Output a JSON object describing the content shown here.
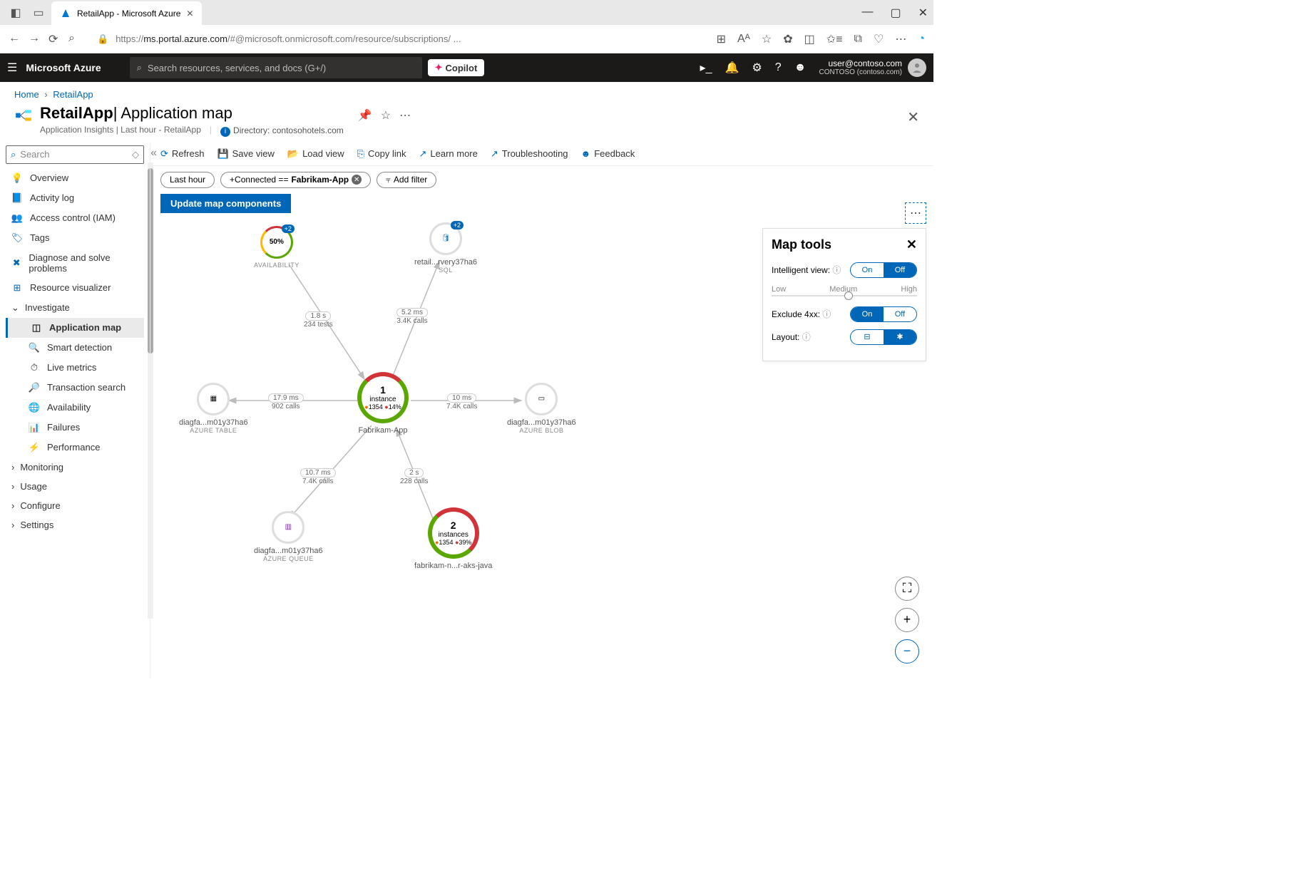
{
  "browser": {
    "tab_title": "RetailApp - Microsoft Azure",
    "url_display_prefix": "https://",
    "url_display_domain": "ms.portal.azure.com",
    "url_display_suffix": "/#@microsoft.onmicrosoft.com/resource/subscriptions/ ..."
  },
  "azure_header": {
    "brand": "Microsoft Azure",
    "search_placeholder": "Search resources, services, and docs (G+/)",
    "copilot": "Copilot",
    "user_email": "user@contoso.com",
    "tenant": "CONTOSO (contoso.com)"
  },
  "breadcrumb": {
    "home": "Home",
    "resource": "RetailApp"
  },
  "page": {
    "title_main": "RetailApp",
    "title_sep": "| ",
    "title_sub": "Application map",
    "subtitle": "Application Insights | Last hour - RetailApp",
    "directory_label": "Directory: ",
    "directory_value": "contosohotels.com"
  },
  "sidebar": {
    "search_placeholder": "Search",
    "items": [
      {
        "icon": "bulb",
        "color": "#8661c5",
        "label": "Overview"
      },
      {
        "icon": "log",
        "color": "#0067b8",
        "label": "Activity log"
      },
      {
        "icon": "iam",
        "color": "#0067b8",
        "label": "Access control (IAM)"
      },
      {
        "icon": "tag",
        "color": "#0067b8",
        "label": "Tags"
      },
      {
        "icon": "diag",
        "color": "#0067b8",
        "label": "Diagnose and solve problems"
      },
      {
        "icon": "viz",
        "color": "#0067b8",
        "label": "Resource visualizer"
      }
    ],
    "investigate_label": "Investigate",
    "investigate": [
      {
        "icon": "map",
        "label": "Application map",
        "selected": true
      },
      {
        "icon": "detect",
        "label": "Smart detection"
      },
      {
        "icon": "live",
        "label": "Live metrics"
      },
      {
        "icon": "search",
        "label": "Transaction search"
      },
      {
        "icon": "avail",
        "label": "Availability"
      },
      {
        "icon": "fail",
        "label": "Failures"
      },
      {
        "icon": "perf",
        "label": "Performance"
      }
    ],
    "groups": [
      "Monitoring",
      "Usage",
      "Configure",
      "Settings"
    ]
  },
  "commands": {
    "refresh": "Refresh",
    "save_view": "Save view",
    "load_view": "Load view",
    "copy_link": "Copy link",
    "learn_more": "Learn more",
    "troubleshooting": "Troubleshooting",
    "feedback": "Feedback"
  },
  "filters": {
    "time": "Last hour",
    "connected_prefix": "+Connected == ",
    "connected_value": "Fabrikam-App",
    "add": "Add filter"
  },
  "update_button": "Update map components",
  "map_tools": {
    "title": "Map tools",
    "intelligent_view": "Intelligent view:",
    "on": "On",
    "off": "Off",
    "low": "Low",
    "medium": "Medium",
    "high": "High",
    "exclude_4xx": "Exclude 4xx:",
    "layout": "Layout:"
  },
  "map": {
    "nodes": {
      "availability": {
        "center": "50%",
        "badge": "+2",
        "label": "AVAILABILITY"
      },
      "sql": {
        "badge": "+2",
        "label": "retail...rvery37ha6",
        "sub": "SQL"
      },
      "fabrikam": {
        "num": "1",
        "text": "instance",
        "m1": "1354",
        "m2": "14%",
        "label": "Fabrikam-App"
      },
      "table": {
        "label": "diagfa...m01y37ha6",
        "sub": "AZURE TABLE"
      },
      "blob": {
        "label": "diagfa...m01y37ha6",
        "sub": "AZURE BLOB"
      },
      "queue": {
        "label": "diagfa...m01y37ha6",
        "sub": "AZURE QUEUE"
      },
      "java": {
        "num": "2",
        "text": "instances",
        "m1": "1354",
        "m2": "39%",
        "label": "fabrikam-n...r-aks-java"
      }
    },
    "edges": {
      "avail_fab": {
        "val": "1.8 s",
        "sub": "234 tests"
      },
      "sql_fab": {
        "val": "5.2 ms",
        "sub": "3.4K calls"
      },
      "fab_table": {
        "val": "17.9 ms",
        "sub": "902 calls"
      },
      "fab_blob": {
        "val": "10 ms",
        "sub": "7.4K calls"
      },
      "fab_queue": {
        "val": "10.7 ms",
        "sub": "7.4K calls"
      },
      "fab_java": {
        "val": "2 s",
        "sub": "228 calls"
      }
    }
  }
}
